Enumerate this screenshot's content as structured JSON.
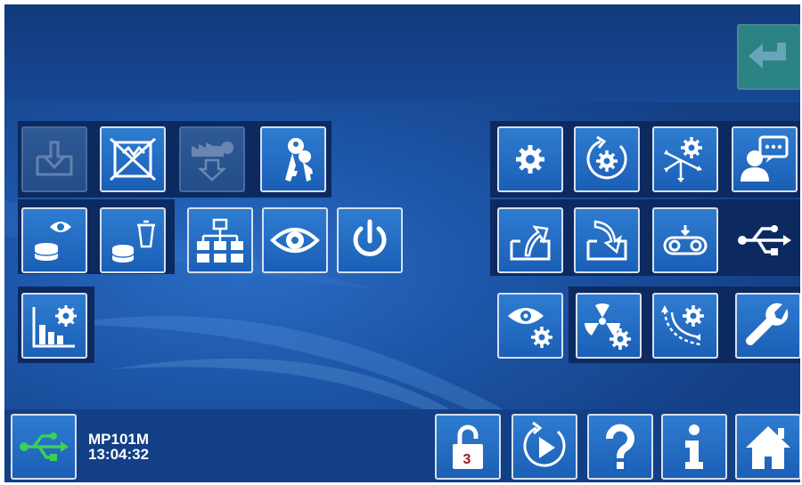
{
  "header": {
    "enter_icon": "enter-return-icon"
  },
  "status": {
    "device_name": "MP101M",
    "time": "13:04:32",
    "usb_icon": "usb-icon"
  },
  "toolbar": {
    "lock_level": "3"
  },
  "colors": {
    "button_fill": "#2272c4",
    "button_border": "#d7e0ee",
    "dark_group": "#0c2a60",
    "enter_button": "#2f8a83",
    "lock_number": "#a01818"
  },
  "left_buttons": [
    {
      "icon": "import-data-icon",
      "state": "disabled"
    },
    {
      "icon": "delete-all-icon",
      "state": "enabled"
    },
    {
      "icon": "factory-download-icon",
      "state": "disabled"
    },
    {
      "icon": "keys-icon",
      "state": "enabled"
    },
    {
      "icon": "view-database-icon",
      "state": "enabled"
    },
    {
      "icon": "delete-database-icon",
      "state": "enabled"
    },
    {
      "icon": "network-icon",
      "state": "enabled"
    },
    {
      "icon": "eye-icon",
      "state": "enabled"
    },
    {
      "icon": "power-icon",
      "state": "enabled"
    },
    {
      "icon": "statistics-settings-icon",
      "state": "enabled"
    }
  ],
  "right_buttons": [
    {
      "icon": "gear-icon"
    },
    {
      "icon": "gear-cycle-icon"
    },
    {
      "icon": "gear-distribution-icon"
    },
    {
      "icon": "user-message-icon"
    },
    {
      "icon": "export-icon"
    },
    {
      "icon": "import-icon"
    },
    {
      "icon": "conveyor-icon"
    },
    {
      "icon": "usb-symbol-icon"
    },
    {
      "icon": "view-settings-icon"
    },
    {
      "icon": "radiation-settings-icon"
    },
    {
      "icon": "calibration-settings-icon"
    },
    {
      "icon": "wrench-icon"
    }
  ]
}
